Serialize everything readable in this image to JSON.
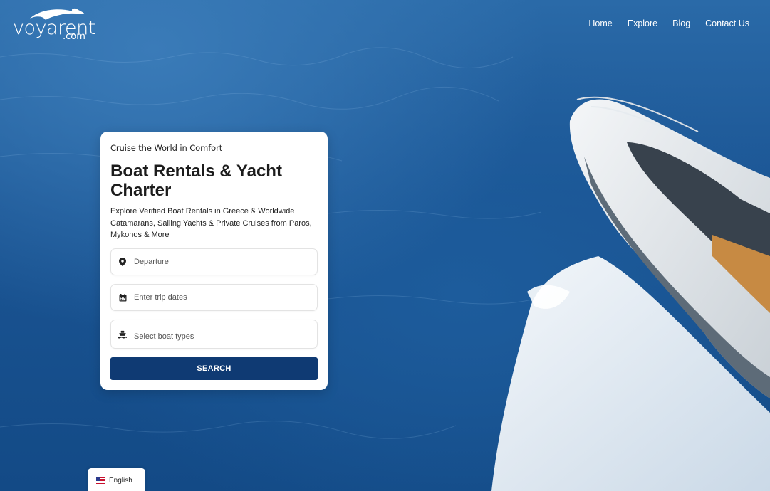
{
  "brand": {
    "logo_main": "voyarent",
    "logo_sub": ".com"
  },
  "nav": {
    "items": [
      {
        "label": "Home"
      },
      {
        "label": "Explore"
      },
      {
        "label": "Blog"
      },
      {
        "label": "Contact Us"
      }
    ]
  },
  "search_card": {
    "eyebrow": "Cruise the World in Comfort",
    "title": "Boat Rentals & Yacht Charter",
    "description": "Explore Verified Boat Rentals in Greece & Worldwide Catamarans, Sailing Yachts & Private Cruises from Paros, Mykonos & More",
    "departure_placeholder": "Departure",
    "dates_placeholder": "Enter trip dates",
    "boat_types_placeholder": "Select boat types",
    "search_label": "SEARCH"
  },
  "language": {
    "label": "English",
    "flag": "us-flag-icon"
  },
  "colors": {
    "accent": "#0f3a73",
    "ocean": "#1b5594"
  }
}
